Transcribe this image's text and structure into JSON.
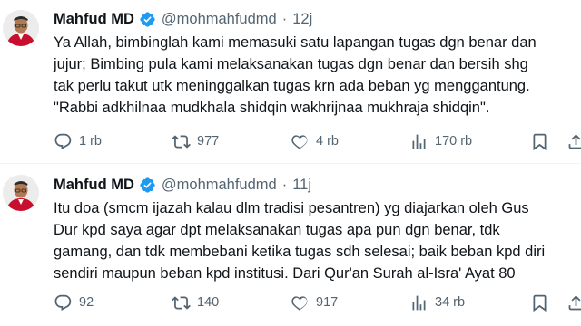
{
  "tweets": [
    {
      "author": {
        "name": "Mahfud MD",
        "handle": "@mohmahfudmd"
      },
      "separator": "·",
      "time": "12j",
      "text": "Ya Allah, bimbinglah kami memasuki satu lapangan tugas dgn benar dan\njujur; Bimbing pula kami melaksanakan  tugas dgn benar dan bersih shg\ntak perlu takut utk meninggalkan tugas krn ada beban yg menggantung.\n\"Rabbi adkhilnaa mudkhala shidqin wakhrijnaa mukhraja shidqin\".",
      "stats": {
        "replies": "1 rb",
        "retweets": "977",
        "likes": "4 rb",
        "views": "170 rb"
      }
    },
    {
      "author": {
        "name": "Mahfud MD",
        "handle": "@mohmahfudmd"
      },
      "separator": "·",
      "time": "11j",
      "text": "Itu doa (smcm ijazah kalau dlm tradisi pesantren) yg diajarkan oleh Gus\nDur kpd saya agar dpt melaksanakan tugas apa pun dgn benar, tdk\ngamang, dan tdk membebani ketika tugas sdh selesai; baik beban kpd diri\nsendiri maupun beban kpd institusi. Dari Qur'an Surah al-Isra' Ayat 80",
      "stats": {
        "replies": "92",
        "retweets": "140",
        "likes": "917",
        "views": "34 rb"
      }
    }
  ],
  "colors": {
    "text": "#0f1419",
    "secondary": "#536471",
    "verified": "#1d9bf0",
    "divider": "#eff3f4"
  },
  "icons": [
    "verified-badge-icon",
    "reply-icon",
    "retweet-icon",
    "like-icon",
    "views-icon",
    "bookmark-icon",
    "share-icon"
  ]
}
